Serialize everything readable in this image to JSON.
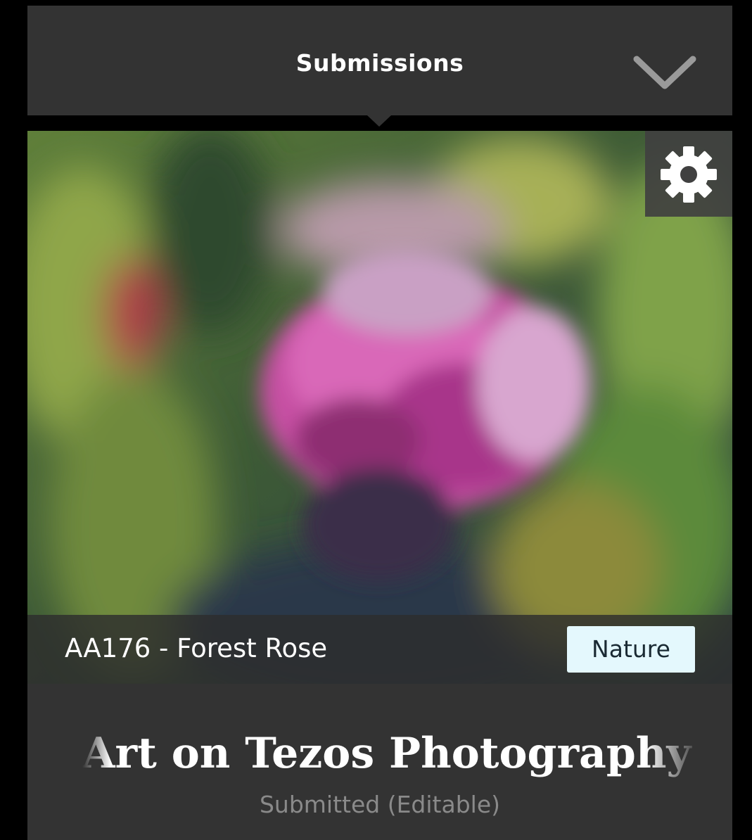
{
  "header": {
    "title": "Submissions",
    "dropdown_icon": "chevron-down-icon"
  },
  "submission": {
    "settings_icon": "gear-icon",
    "caption": "AA176 - Forest Rose",
    "category_tag": "Nature",
    "contest_title": "Art on Tezos Photography P",
    "status": "Submitted (Editable)"
  },
  "colors": {
    "background": "#000000",
    "panel": "#333333",
    "tag_background": "#e4f8fd",
    "status_text": "#8a8a8a"
  }
}
